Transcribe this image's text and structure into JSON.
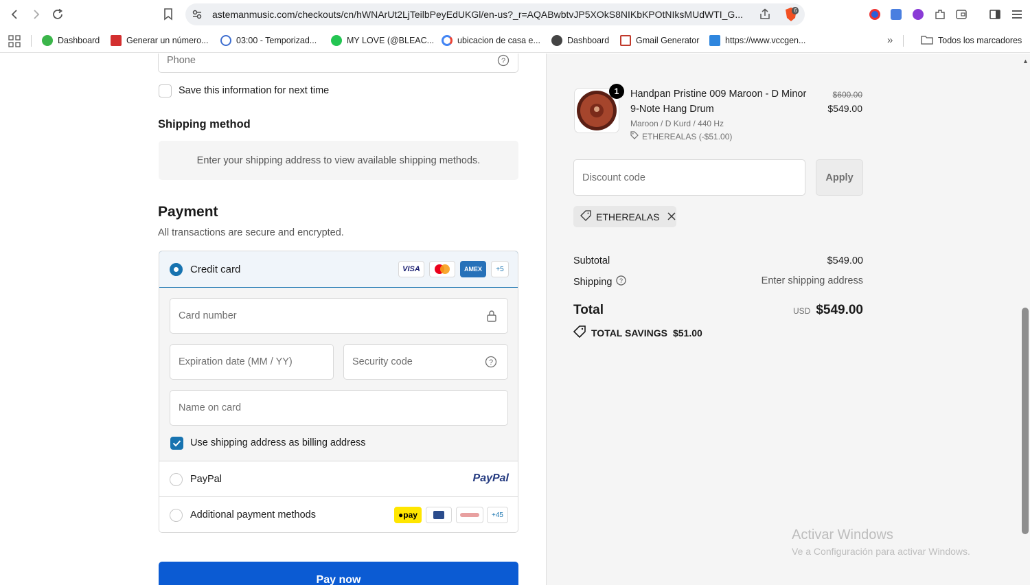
{
  "browser": {
    "url": "astemanmusic.com/checkouts/cn/hWNArUt2LjTeilbPeyEdUKGl/en-us?_r=AQABwbtvJP5XOkS8NIKbKPOtNIksMUdWTI_G...",
    "shield_count": "6",
    "bookmarks": [
      {
        "label": "Dashboard",
        "icon": "leaf-icon",
        "color": "#3bb54a"
      },
      {
        "label": "Generar un número...",
        "icon": "f-icon",
        "color": "#d32f2f"
      },
      {
        "label": "03:00 - Temporizad...",
        "icon": "check-icon",
        "color": "#3f6fd0"
      },
      {
        "label": "MY LOVE (@BLEAC...",
        "icon": "bolt-icon",
        "color": "#23c552"
      },
      {
        "label": "ubicacion de casa e...",
        "icon": "google-icon",
        "color": "#4285f4"
      },
      {
        "label": "Dashboard",
        "icon": "gear-icon",
        "color": "#444444"
      },
      {
        "label": "Gmail Generator",
        "icon": "mail-icon",
        "color": "#c0392b"
      },
      {
        "label": "https://www.vccgen...",
        "icon": "v-icon",
        "color": "#2e86de"
      }
    ],
    "all_bookmarks": "Todos los marcadores"
  },
  "form": {
    "phone_placeholder": "Phone",
    "save_info_label": "Save this information for next time",
    "shipping_title": "Shipping method",
    "shipping_notice": "Enter your shipping address to view available shipping methods.",
    "payment_title": "Payment",
    "payment_subtitle": "All transactions are secure and encrypted.",
    "credit_card_label": "Credit card",
    "card_brands": [
      "VISA",
      "AMEX",
      "+5"
    ],
    "card_number_placeholder": "Card number",
    "expiration_placeholder": "Expiration date (MM / YY)",
    "security_placeholder": "Security code",
    "name_placeholder": "Name on card",
    "billing_label": "Use shipping address as billing address",
    "paypal_label": "PayPal",
    "paypal_logo": "PayPal",
    "additional_label": "Additional payment methods",
    "additional_count": "+45",
    "gpay_label": "pay",
    "pay_now": "Pay now"
  },
  "summary": {
    "item_qty": "1",
    "item_title_1": "Handpan Pristine 009 Maroon - D Minor",
    "item_title_2": "9-Note Hang Drum",
    "item_variant": "Maroon / D Kurd / 440 Hz",
    "item_discount": "ETHEREALAS (-$51.00)",
    "item_original_price": "$600.00",
    "item_price": "$549.00",
    "discount_placeholder": "Discount code",
    "apply_label": "Apply",
    "applied_code": "ETHEREALAS",
    "subtotal_label": "Subtotal",
    "subtotal_value": "$549.00",
    "shipping_label": "Shipping",
    "shipping_value": "Enter shipping address",
    "total_label": "Total",
    "currency": "USD",
    "total_value": "$549.00",
    "savings_label": "TOTAL SAVINGS",
    "savings_value": "$51.00"
  },
  "watermark": {
    "title": "Activar Windows",
    "subtitle": "Ve a Configuración para activar Windows."
  },
  "colors": {
    "accent": "#1773b0",
    "pay_button": "#0b5bd3",
    "selected_bg": "#f0f5fa"
  }
}
